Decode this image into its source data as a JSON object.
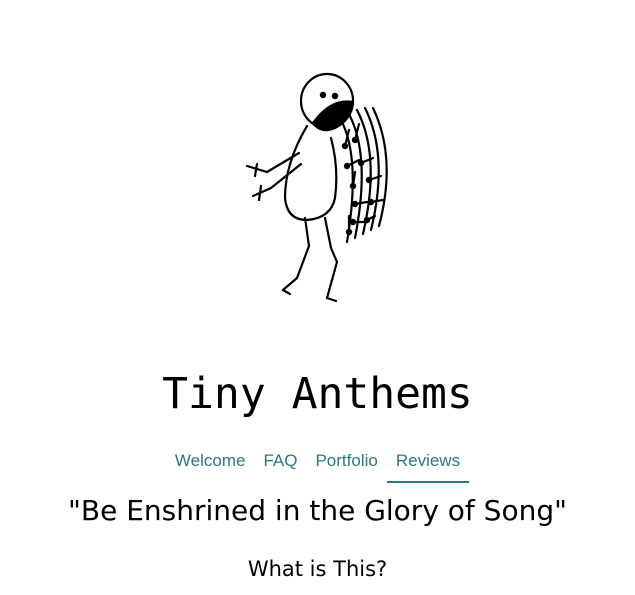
{
  "header": {
    "logo_icon": "singing-stick-figure-icon",
    "title": "Tiny Anthems"
  },
  "nav": {
    "items": [
      {
        "label": "Welcome",
        "active": false
      },
      {
        "label": "FAQ",
        "active": false
      },
      {
        "label": "Portfolio",
        "active": false
      },
      {
        "label": "Reviews",
        "active": true
      }
    ],
    "accent_color": "#2f7680"
  },
  "main": {
    "tagline": "\"Be Enshrined in the Glory of Song\"",
    "section_heading": "What is This?"
  }
}
